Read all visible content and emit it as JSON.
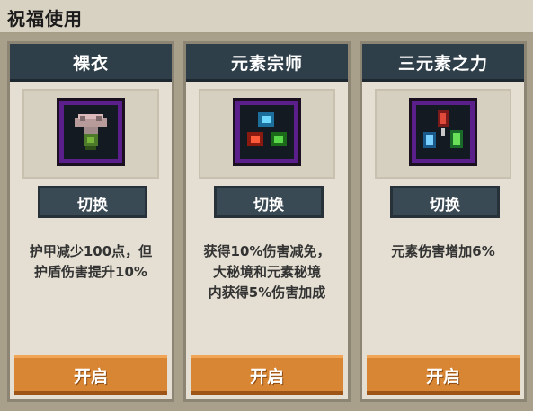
{
  "window": {
    "title": "祝福使用"
  },
  "cards": [
    {
      "name": "裸衣",
      "icon": "robe-icon",
      "switch_label": "切换",
      "description": "护甲减少100点，但\n护盾伤害提升10%",
      "open_label": "开启"
    },
    {
      "name": "元素宗师",
      "icon": "element-master-icon",
      "switch_label": "切换",
      "description": "获得10%伤害减免，\n大秘境和元素秘境\n内获得5%伤害加成",
      "open_label": "开启"
    },
    {
      "name": "三元素之力",
      "icon": "three-elements-icon",
      "switch_label": "切换",
      "description": "元素伤害增加6%",
      "open_label": "开启"
    }
  ],
  "colors": {
    "header_bg": "#2f3f4a",
    "open_button": "#d88634",
    "icon_frame": "#5a1f8a"
  }
}
